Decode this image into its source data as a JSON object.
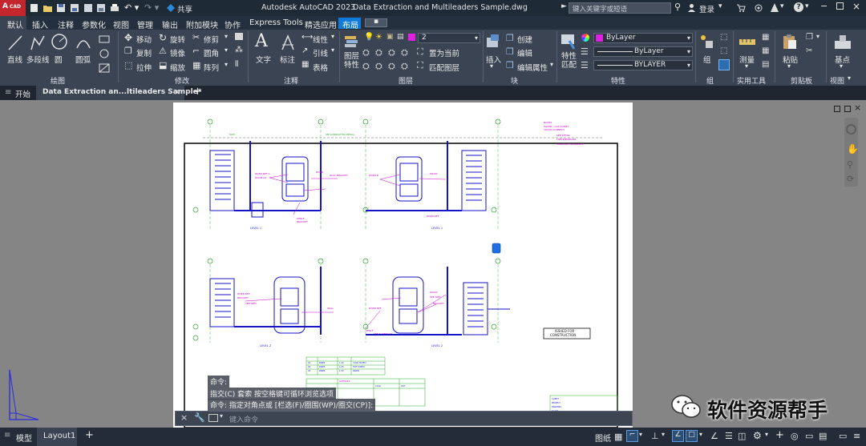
{
  "app": {
    "title": "Autodesk AutoCAD 2023",
    "document": "Data Extraction and Multileaders Sample.dwg",
    "logo_text": "CAD",
    "share_label": "共享",
    "search_placeholder": "键入关键字或短语",
    "login_label": "登录"
  },
  "ribbon_tabs": [
    "默认",
    "插入",
    "注释",
    "参数化",
    "视图",
    "管理",
    "输出",
    "附加模块",
    "协作",
    "Express Tools",
    "精选应用",
    "布局"
  ],
  "ribbon": {
    "draw": {
      "label": "绘图",
      "line": "直线",
      "polyline": "多段线",
      "circle": "圆",
      "arc": "圆弧"
    },
    "modify": {
      "label": "修改",
      "move": "移动",
      "rotate": "旋转",
      "trim": "修剪",
      "copy": "复制",
      "mirror": "镜像",
      "fillet": "圆角",
      "stretch": "拉伸",
      "scale": "缩放",
      "array": "阵列"
    },
    "annotation": {
      "label": "注释",
      "text": "文字",
      "dimension": "标注",
      "linear": "线性",
      "leader": "引线",
      "table": "表格"
    },
    "layers": {
      "label": "图层",
      "properties": "图层\n特性",
      "current_layer": "2",
      "set_current": "置为当前",
      "match_layer": "匹配图层"
    },
    "block": {
      "label": "块",
      "insert": "插入",
      "create": "创建",
      "edit": "编辑",
      "edit_attributes": "编辑属性"
    },
    "properties": {
      "label": "特性",
      "match": "特性\n匹配",
      "color": "ByLayer",
      "linetype": "ByLayer",
      "lineweight": "BYLAYER"
    },
    "groups": {
      "label": "组",
      "group": "组"
    },
    "utilities": {
      "label": "实用工具",
      "measure": "测量"
    },
    "clipboard": {
      "label": "剪贴板",
      "paste": "粘贴"
    },
    "view": {
      "label": "视图",
      "base": "基点"
    }
  },
  "doc_tabs": {
    "start": "开始",
    "active": "Data Extraction an...ltileaders Sample*",
    "add": "+"
  },
  "drawing": {
    "level_labels": [
      "LEVEL 1",
      "LEVEL 1",
      "LEVEL 2",
      "LEVEL 2"
    ],
    "stamp": [
      "ISSUED FOR",
      "CONSTRUCTION"
    ]
  },
  "command": {
    "history": [
      "命令:",
      "指交(C) 套索  按空格键可循环浏览选项",
      "命令: 指定对角点或 [栏选(F)/圈围(WP)/圈交(CP)]:"
    ],
    "placeholder": "键入命令"
  },
  "layout_tabs": [
    "模型",
    "Layout1",
    "+"
  ],
  "status": {
    "paper": "图纸"
  },
  "watermark": "软件资源帮手",
  "colors": {
    "accent": "#0f7ad8",
    "drawing_blue": "#1515c8",
    "drawing_magenta": "#cc00cc",
    "drawing_green": "#22aa22"
  }
}
